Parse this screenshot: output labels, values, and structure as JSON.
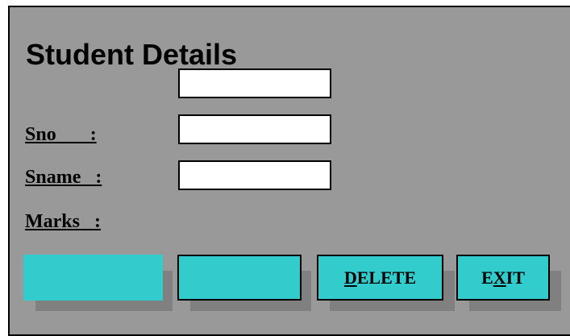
{
  "form": {
    "title": "Student Details",
    "labels": {
      "sno": "Sno       :",
      "sname": "Sname   :",
      "marks": "Marks   :"
    },
    "fields": {
      "top": "",
      "sno": "",
      "sname": ""
    }
  },
  "buttons": {
    "button1": "",
    "button2": "",
    "delete": {
      "mnemonic": "D",
      "rest": "ELETE"
    },
    "exit": {
      "prefix": "E",
      "mnemonic": "X",
      "rest": "IT"
    }
  },
  "colors": {
    "panel": "#999999",
    "button": "#33cccc",
    "shadow": "#808080"
  }
}
